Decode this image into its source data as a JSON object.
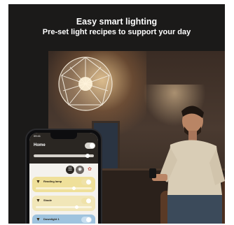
{
  "headline": {
    "line1": "Easy smart lighting",
    "line2": "Pre-set light recipes to support your day"
  },
  "phone": {
    "status_time": "09:41",
    "room_name": "Home",
    "main_toggle_on": true,
    "main_brightness": 0.8,
    "icons": [
      "scenes-icon",
      "color-picker-icon",
      "palette-icon"
    ],
    "lights": [
      {
        "name": "Reading lamp",
        "on": true,
        "brightness": 0.65,
        "color": "#efe09a"
      },
      {
        "name": "Shade",
        "on": true,
        "brightness": 0.7,
        "color": "#f1e6b8"
      },
      {
        "name": "Downlight 1",
        "on": true,
        "brightness": 0.6,
        "color": "#9fc3de"
      }
    ]
  },
  "colors": {
    "background": "#1b1a19",
    "headline_text": "#ffffff"
  }
}
